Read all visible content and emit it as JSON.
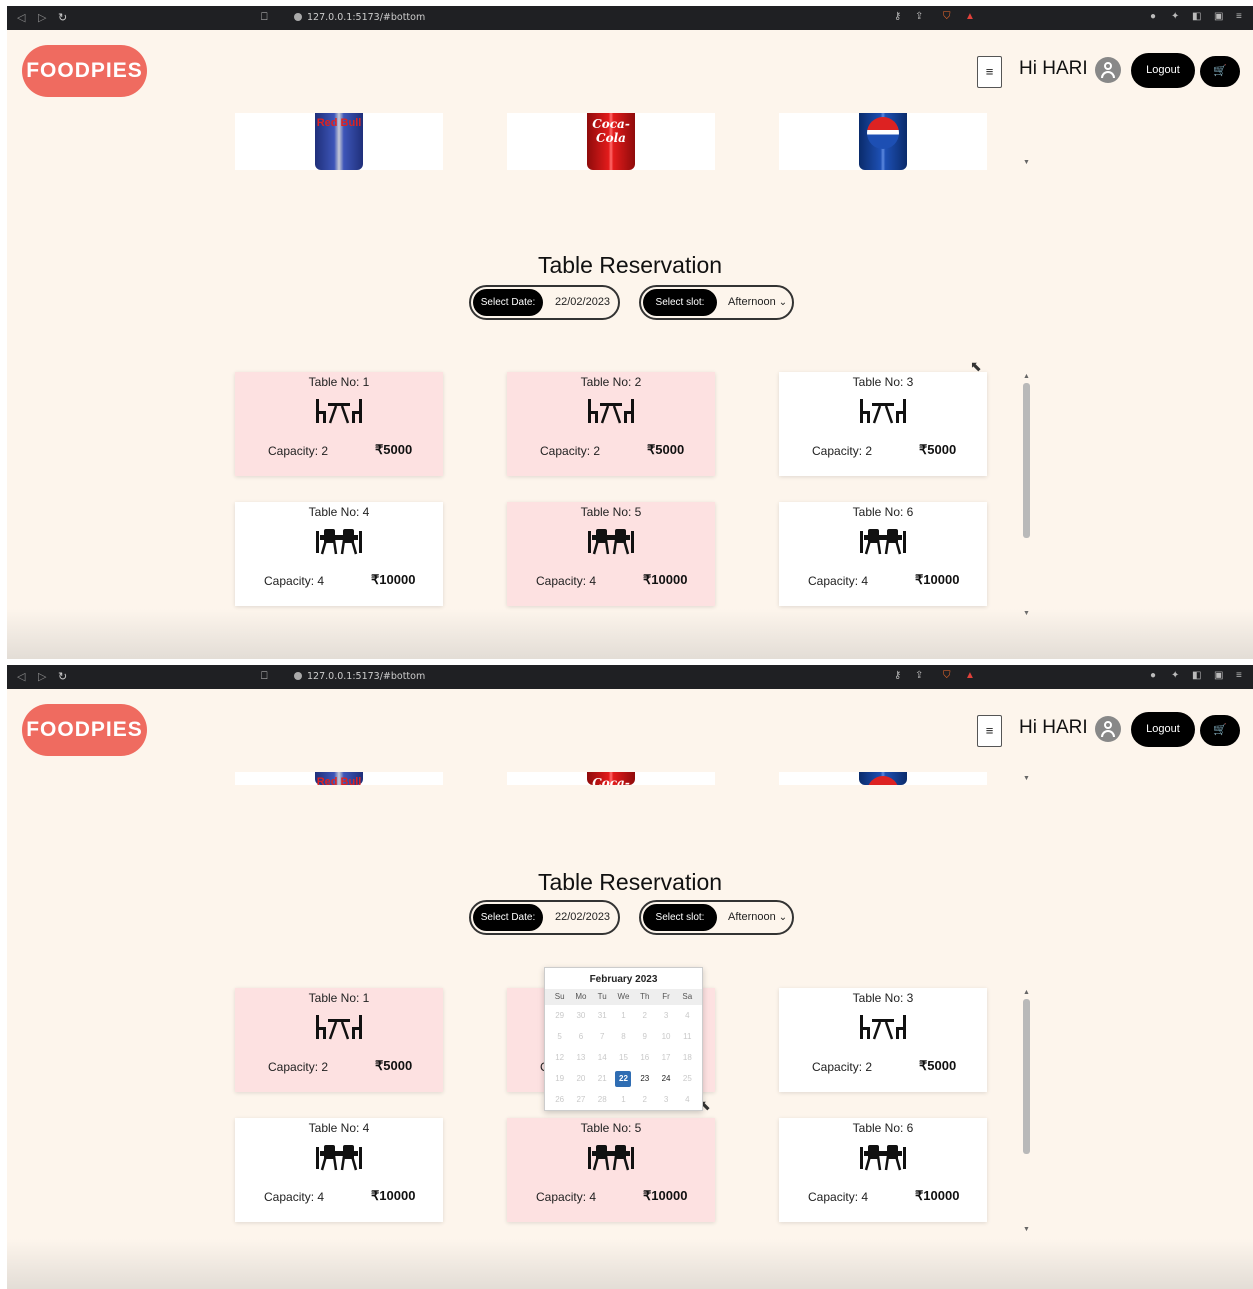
{
  "browser": {
    "url": "127.0.0.1:5173/#bottom"
  },
  "header": {
    "logo": "FOODPIES",
    "menu_icon": "≡",
    "greeting": "Hi HARI",
    "logout_label": "Logout",
    "cart_icon": "🛒"
  },
  "drinks": [
    {
      "name": "Red Bull",
      "label": "Red Bull"
    },
    {
      "name": "Coca-Cola",
      "label": "Coca-Cola"
    },
    {
      "name": "Pepsi",
      "label": "pepsi"
    }
  ],
  "reservation": {
    "title": "Table Reservation",
    "date_label": "Select Date:",
    "date_value": "22/02/2023",
    "slot_label": "Select slot:",
    "slot_value": "Afternoon"
  },
  "tables": [
    {
      "name": "Table No: 1",
      "capacity": "Capacity: 2",
      "price": "₹5000",
      "booked": true,
      "icon": "table-2-seat-icon"
    },
    {
      "name": "Table No: 2",
      "capacity": "Capacity: 2",
      "price": "₹5000",
      "booked": true,
      "icon": "table-2-seat-icon"
    },
    {
      "name": "Table No: 3",
      "capacity": "Capacity: 2",
      "price": "₹5000",
      "booked": false,
      "icon": "table-2-seat-icon"
    },
    {
      "name": "Table No: 4",
      "capacity": "Capacity: 4",
      "price": "₹10000",
      "booked": false,
      "icon": "table-4-seat-icon"
    },
    {
      "name": "Table No: 5",
      "capacity": "Capacity: 4",
      "price": "₹10000",
      "booked": true,
      "icon": "table-4-seat-icon"
    },
    {
      "name": "Table No: 6",
      "capacity": "Capacity: 4",
      "price": "₹10000",
      "booked": false,
      "icon": "table-4-seat-icon"
    }
  ],
  "calendar": {
    "month": "February 2023",
    "weekdays": [
      "Su",
      "Mo",
      "Tu",
      "We",
      "Th",
      "Fr",
      "Sa"
    ],
    "weeks": [
      [
        "29",
        "30",
        "31",
        "1",
        "2",
        "3",
        "4"
      ],
      [
        "5",
        "6",
        "7",
        "8",
        "9",
        "10",
        "11"
      ],
      [
        "12",
        "13",
        "14",
        "15",
        "16",
        "17",
        "18"
      ],
      [
        "19",
        "20",
        "21",
        "22",
        "23",
        "24",
        "25"
      ],
      [
        "26",
        "27",
        "28",
        "1",
        "2",
        "3",
        "4"
      ]
    ],
    "selected": "22",
    "enabled": [
      "23",
      "24"
    ]
  },
  "colors": {
    "brand": "#ef6b60",
    "background": "#fdf5ec",
    "booked_card": "#fde1e1",
    "selected_day": "#2f6db3"
  }
}
